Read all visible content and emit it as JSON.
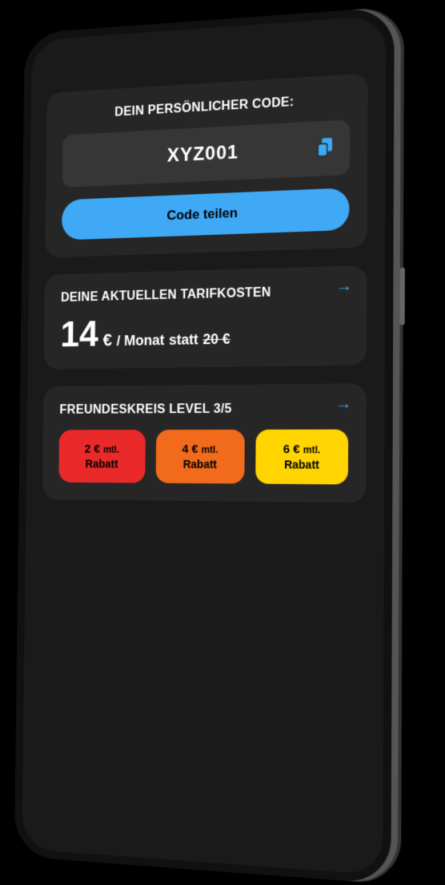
{
  "code_card": {
    "title": "DEIN PERSÖNLICHER CODE:",
    "code": "XYZ001",
    "share_button": "Code teilen"
  },
  "tariff_card": {
    "title": "DEINE AKTUELLEN TARIFKOSTEN",
    "amount": "14",
    "currency": "€",
    "per": "/ Monat",
    "instead_word": "statt",
    "old_price": "20 €"
  },
  "level_card": {
    "title": "FREUNDESKREIS LEVEL 3/5",
    "tiles": [
      {
        "amount": "2 €",
        "suffix": "mtl.",
        "label": "Rabatt",
        "class": "lvl-red"
      },
      {
        "amount": "4 €",
        "suffix": "mtl.",
        "label": "Rabatt",
        "class": "lvl-orange"
      },
      {
        "amount": "6 €",
        "suffix": "mtl.",
        "label": "Rabatt",
        "class": "lvl-yellow"
      }
    ]
  }
}
